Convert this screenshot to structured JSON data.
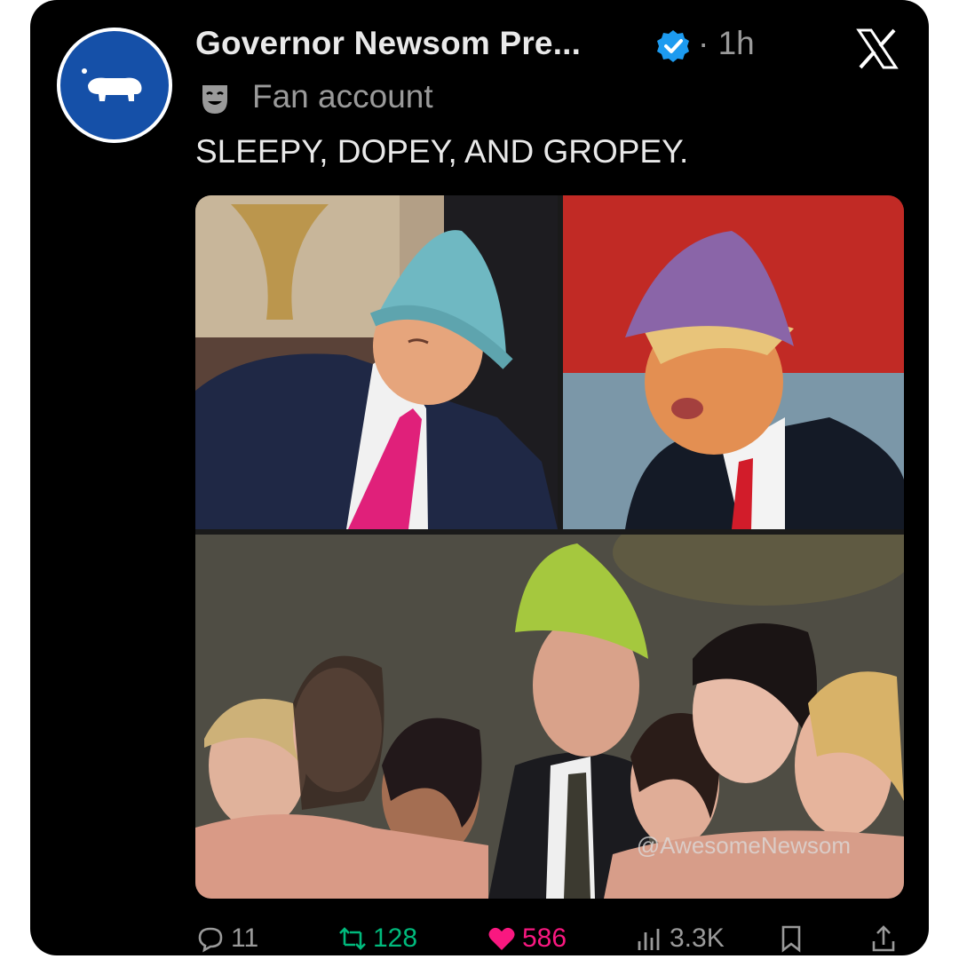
{
  "post": {
    "author_name": "Governor Newsom Pre...",
    "separator_time": "· 1h",
    "account_label": "Fan account",
    "text": "SLEEPY, DOPEY, AND GROPEY.",
    "watermark": "@AwesomeNewsom"
  },
  "icons": {
    "avatar": "hippo-icon",
    "verified": "verified-badge-icon",
    "platform": "x-logo-icon",
    "account_type": "theater-mask-icon"
  },
  "actions": {
    "replies": "11",
    "reposts": "128",
    "likes": "586",
    "views": "3.3K"
  },
  "colors": {
    "background": "#000000",
    "text_primary": "#e9e9e9",
    "text_secondary": "#9a9a9a",
    "verified": "#1d9bf0",
    "repost": "#00ba7c",
    "like": "#f91880",
    "avatar": "#1550a8"
  }
}
